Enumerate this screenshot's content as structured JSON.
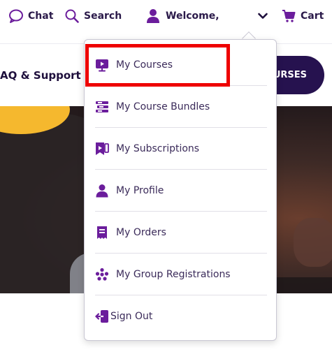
{
  "topbar": {
    "chat_label": "Chat",
    "search_label": "Search",
    "welcome_label": "Welcome,",
    "cart_label": "Cart"
  },
  "nav": {
    "faq_label": "AQ & Support",
    "cta_label": "URSES"
  },
  "dropdown": {
    "items": [
      {
        "label": "My Courses",
        "icon": "monitor-play-icon"
      },
      {
        "label": "My Course Bundles",
        "icon": "stack-icon"
      },
      {
        "label": "My Subscriptions",
        "icon": "subscription-play-icon"
      },
      {
        "label": "My Profile",
        "icon": "person-icon"
      },
      {
        "label": "My Orders",
        "icon": "receipt-icon"
      },
      {
        "label": "My Group Registrations",
        "icon": "group-icon"
      },
      {
        "label": "Sign Out",
        "icon": "sign-out-icon"
      }
    ]
  },
  "colors": {
    "brand_purple": "#6b1d9c",
    "navy": "#26124f",
    "highlight_red": "#ee0000",
    "accent_yellow": "#f5b82e"
  }
}
